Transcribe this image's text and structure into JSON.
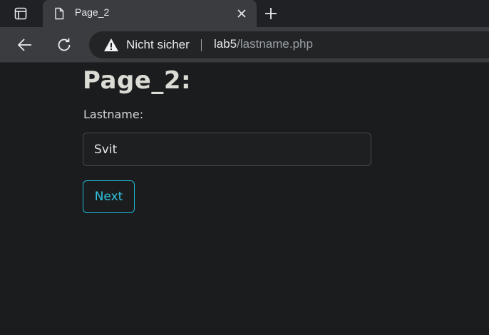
{
  "browser": {
    "tab": {
      "title": "Page_2",
      "favicon": "page-icon"
    },
    "toolbar": {
      "back_icon": "back-arrow-icon",
      "reload_icon": "reload-icon",
      "security_label": "Nicht sicher",
      "security_icon": "warning-triangle-icon",
      "url_host": "lab5",
      "url_path": "/lastname.php"
    }
  },
  "page": {
    "heading": "Page_2:",
    "form": {
      "lastname_label": "Lastname:",
      "lastname_value": "Svit",
      "next_button_label": "Next"
    }
  },
  "colors": {
    "page_background": "#1b1c1e",
    "accent": "#1fb6d3",
    "chrome_background": "#202124",
    "toolbar_background": "#3b3c3f"
  }
}
